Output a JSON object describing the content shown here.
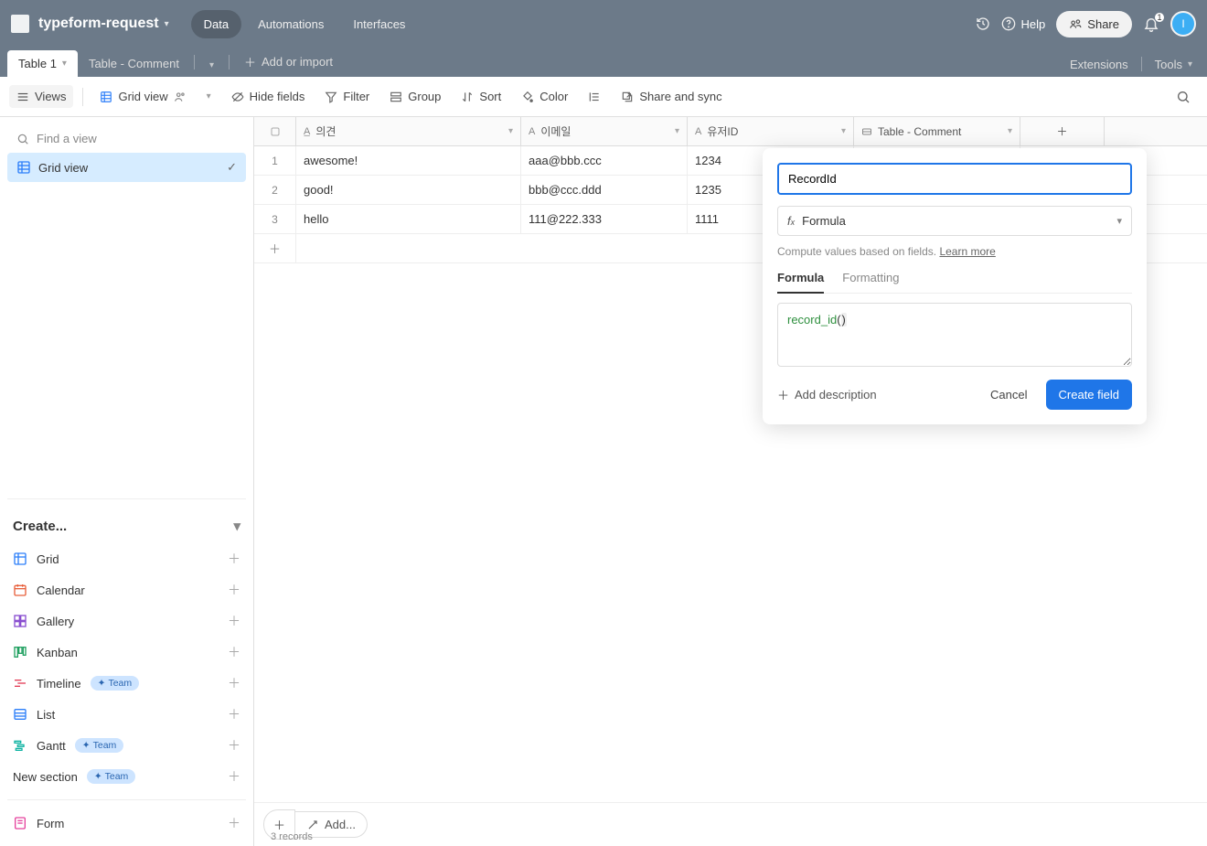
{
  "header": {
    "baseName": "typeform-request",
    "tabs": {
      "data": "Data",
      "automations": "Automations",
      "interfaces": "Interfaces"
    },
    "help": "Help",
    "share": "Share",
    "notifCount": "1",
    "avatar": "I"
  },
  "tabsBar": {
    "tab1": "Table 1",
    "tab2": "Table - Comment",
    "addOrImport": "Add or import",
    "extensions": "Extensions",
    "tools": "Tools"
  },
  "toolbar": {
    "views": "Views",
    "gridView": "Grid view",
    "hideFields": "Hide fields",
    "filter": "Filter",
    "group": "Group",
    "sort": "Sort",
    "color": "Color",
    "shareSync": "Share and sync"
  },
  "sidebar": {
    "findPlaceholder": "Find a view",
    "gridView": "Grid view",
    "createHeader": "Create...",
    "items": {
      "grid": "Grid",
      "calendar": "Calendar",
      "gallery": "Gallery",
      "kanban": "Kanban",
      "timeline": "Timeline",
      "list": "List",
      "gantt": "Gantt",
      "newSection": "New section",
      "form": "Form"
    },
    "teamBadge": "Team"
  },
  "grid": {
    "columns": {
      "c1": "의견",
      "c2": "이메일",
      "c3": "유저ID",
      "c4": "Table - Comment"
    },
    "rows": [
      {
        "n": "1",
        "c1": "awesome!",
        "c2": "aaa@bbb.ccc",
        "c3": "1234"
      },
      {
        "n": "2",
        "c1": "good!",
        "c2": "bbb@ccc.ddd",
        "c3": "1235"
      },
      {
        "n": "3",
        "c1": "hello",
        "c2": "111@222.333",
        "c3": "1111"
      }
    ],
    "addLabel": "Add...",
    "recordCount": "3 records"
  },
  "popup": {
    "nameValue": "RecordId",
    "typeLabel": "Formula",
    "desc": "Compute values based on fields. ",
    "learnMore": "Learn more",
    "tabFormula": "Formula",
    "tabFormatting": "Formatting",
    "formulaFn": "record_id",
    "formulaParenOpen": "(",
    "formulaParenClose": ")",
    "addDescription": "Add description",
    "cancel": "Cancel",
    "create": "Create field"
  }
}
